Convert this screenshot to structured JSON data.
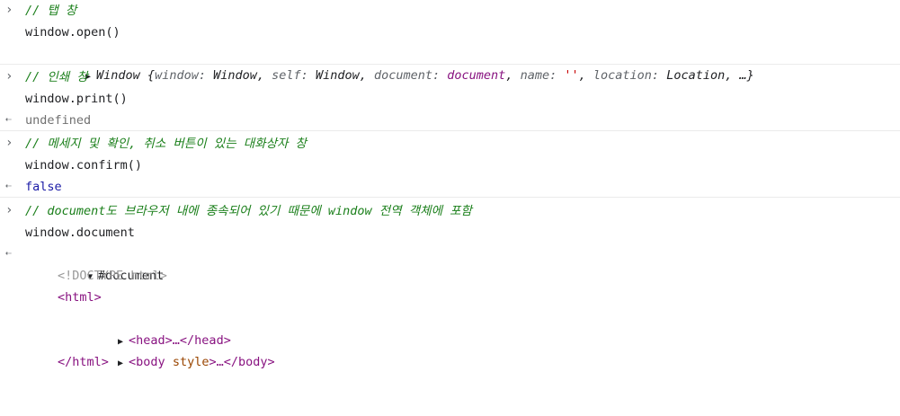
{
  "prompt_glyph": "›",
  "result_glyph": "⇠",
  "entries": [
    {
      "comment": "// 탭 창",
      "code": "window.open()",
      "result": {
        "prefix": "Window {",
        "k1": "window",
        "v1": "Window",
        "k2": "self",
        "v2": "Window",
        "k3": "document",
        "v3": "document",
        "k4": "name",
        "v4": "''",
        "k5": "location",
        "v5": "Location",
        "suffix": "…}"
      }
    },
    {
      "comment": "// 인쇄 창",
      "code": "window.print()",
      "result": "undefined"
    },
    {
      "comment": "// 메세지 및 확인, 취소 버튼이 있는 대화상자 창",
      "code": "window.confirm()",
      "result": "false"
    },
    {
      "comment": "// document도 브라우저 내에 종속되어 있기 때문에 window 전역 객체에 포함",
      "code": "window.document",
      "result": {
        "root": "#document",
        "doctype": "<!DOCTYPE html>",
        "html_open": "<html>",
        "head": "<head>…</head>",
        "body_open": "<body",
        "body_attr": "style",
        "body_rest": ">…</body>",
        "html_close": "</html>"
      }
    }
  ]
}
